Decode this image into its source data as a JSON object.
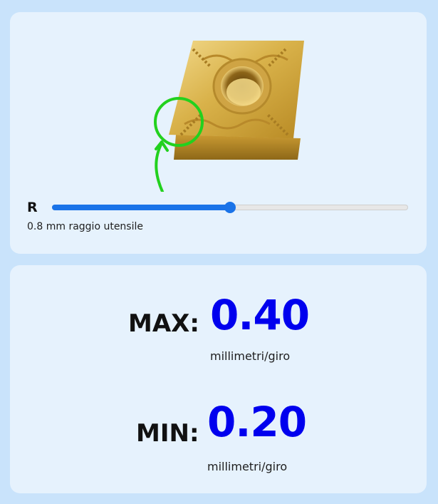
{
  "tool": {
    "slider_label": "R",
    "radius_value": "0.8",
    "caption": "0.8 mm raggio utensile",
    "slider_position_fraction": 0.5
  },
  "feed": {
    "max_label": "MAX:",
    "max_value": "0.40",
    "max_unit": "millimetri/giro",
    "min_label": "MIN:",
    "min_value": "0.20",
    "min_unit": "millimetri/giro"
  },
  "colors": {
    "page_background": "#c9e3fb",
    "card_background": "#e6f2fd",
    "accent_blue": "#1a73e8",
    "value_blue": "#0000ee",
    "highlight_green": "#22d11e",
    "insert_gold": "#d9b24a"
  },
  "icons": {
    "insert_image": "cnmg-turning-insert",
    "highlight": "nose-radius-circle-arrow"
  }
}
